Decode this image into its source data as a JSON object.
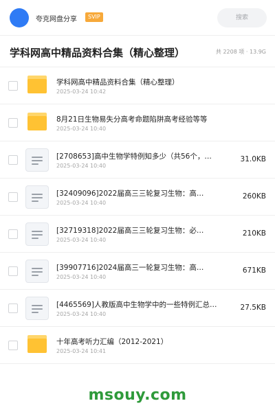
{
  "header": {
    "share_name": "夸克网盘分享",
    "badge": "SVIP",
    "search_placeholder": "搜索",
    "colors": {
      "avatar": "#2f7bf5",
      "badge": "#f7a93a"
    }
  },
  "folder": {
    "title": "学科网高中精品资料合集（精心整理）",
    "meta": "共 2208 项 · 13.9G"
  },
  "files": [
    {
      "type": "folder",
      "icon": "folder-icon",
      "name": "学科网高中精品资料合集（精心整理）",
      "date": "2025-03-24 10:42",
      "size": ""
    },
    {
      "type": "folder",
      "icon": "folder-icon",
      "name": "8月21日生物易失分高考命题陷阱高考经验等等",
      "date": "2025-03-24 10:40",
      "size": ""
    },
    {
      "type": "doc",
      "icon": "document-icon",
      "name": "[2708653]高中生物学特例知多少（共56个，…",
      "date": "2025-03-24 10:40",
      "size": "31.0KB"
    },
    {
      "type": "doc",
      "icon": "document-icon",
      "name": "[32409096]2022届高三三轮复习生物：高…",
      "date": "2025-03-24 10:40",
      "size": "260KB"
    },
    {
      "type": "doc",
      "icon": "document-icon",
      "name": "[32719318]2022届高三三轮复习生物：必…",
      "date": "2025-03-24 10:40",
      "size": "210KB"
    },
    {
      "type": "doc",
      "icon": "document-icon",
      "name": "[39907716]2024届高三一轮复习生物：高…",
      "date": "2025-03-24 10:40",
      "size": "671KB"
    },
    {
      "type": "doc",
      "icon": "document-icon",
      "name": "[4465569]人教版高中生物学中的一些特例汇总…",
      "date": "2025-03-24 10:40",
      "size": "27.5KB"
    },
    {
      "type": "folder",
      "icon": "folder-icon",
      "name": "十年高考听力汇编（2012-2021）",
      "date": "2025-03-24 10:41",
      "size": ""
    }
  ],
  "watermark": "msouy.com"
}
